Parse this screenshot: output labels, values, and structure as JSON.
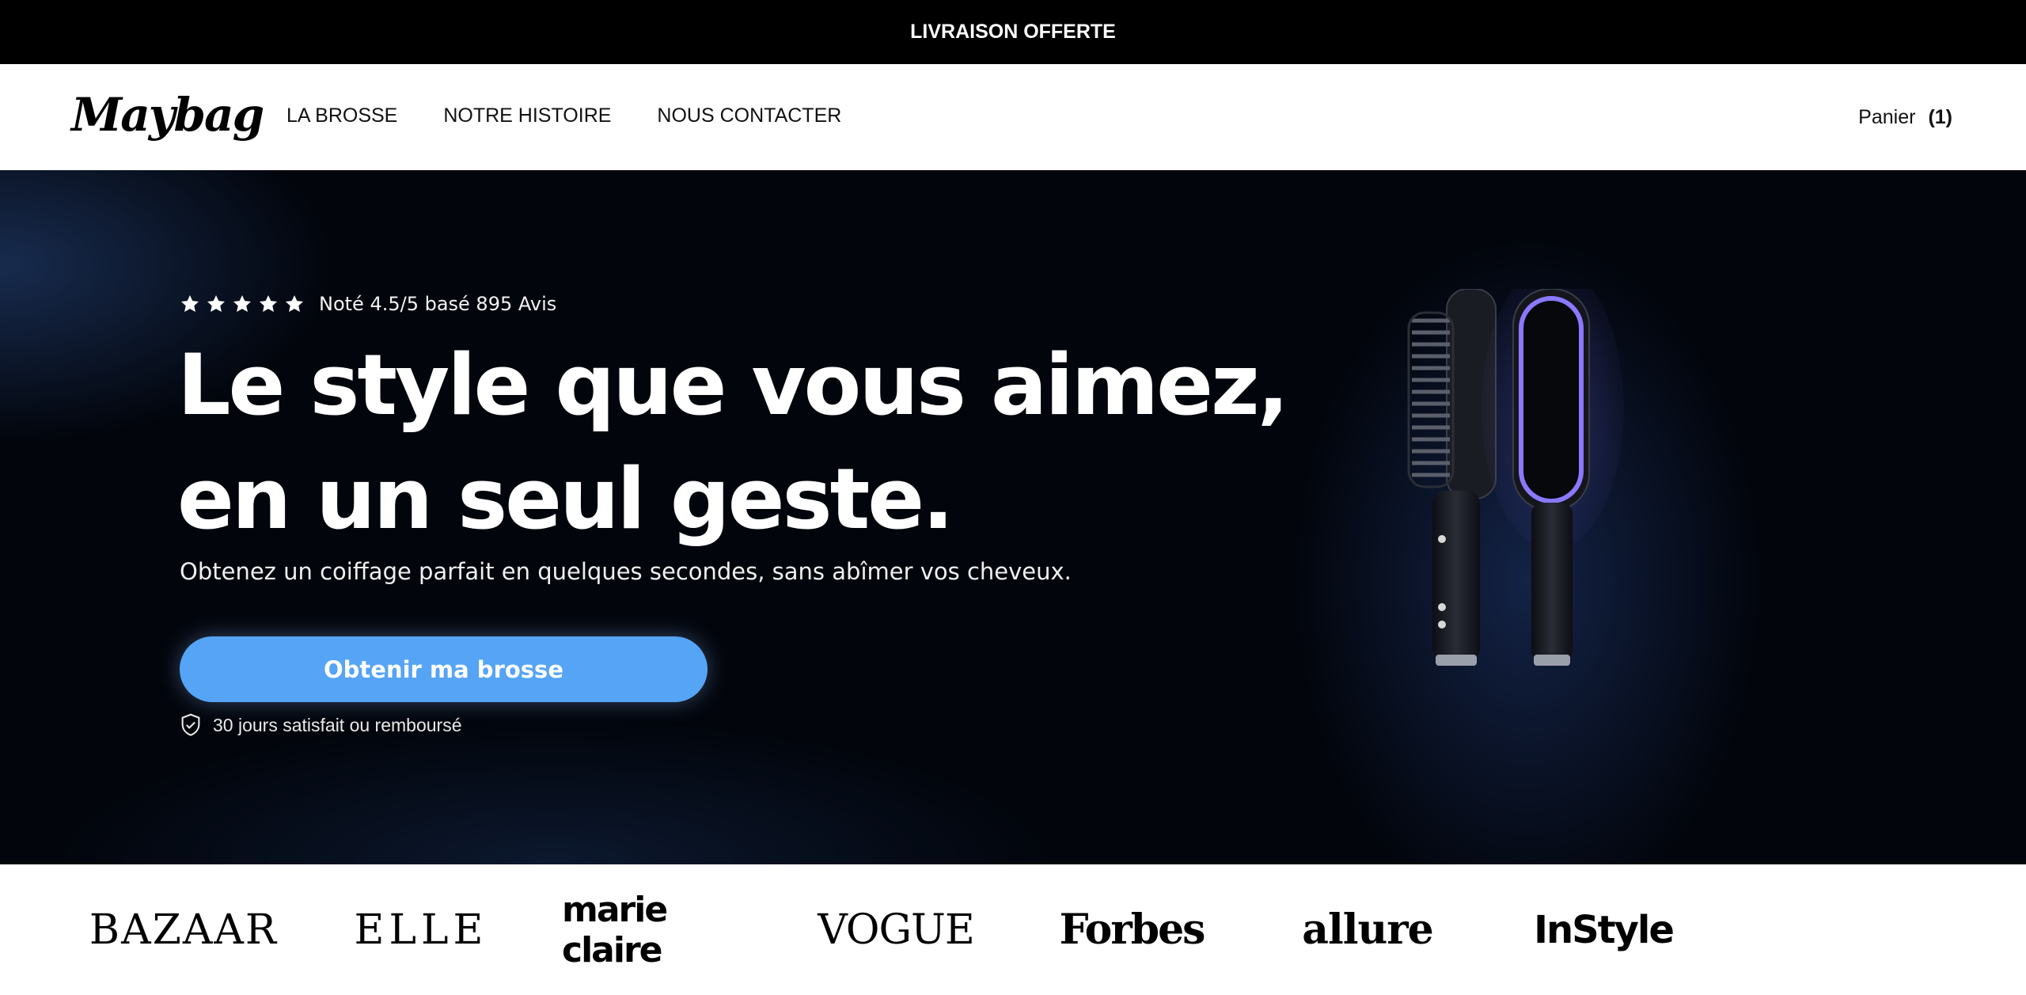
{
  "announcement": {
    "text": "LIVRAISON OFFERTE"
  },
  "header": {
    "logo": "Maybag",
    "nav": [
      {
        "label": "LA BROSSE"
      },
      {
        "label": "NOTRE HISTOIRE"
      },
      {
        "label": "NOUS CONTACTER"
      }
    ],
    "cart": {
      "label": "Panier",
      "count": "(1)"
    }
  },
  "hero": {
    "rating": {
      "stars": 5,
      "text": "Noté 4.5/5 basé 895 Avis"
    },
    "headline_line1": "Le style que vous aimez,",
    "headline_line2": "en un seul geste.",
    "subline": "Obtenez un coiffage parfait en quelques secondes, sans abîmer vos cheveux.",
    "cta_label": "Obtenir ma brosse",
    "guarantee": "30 jours satisfait ou remboursé",
    "colors": {
      "background": "#02050c",
      "cta": "#55a4f6",
      "brush_glow": "#7d6cf0"
    }
  },
  "press": {
    "logos": [
      "BAZAAR",
      "ELLE",
      "marie claire",
      "VOGUE",
      "Forbes",
      "allure",
      "InStyle"
    ]
  }
}
